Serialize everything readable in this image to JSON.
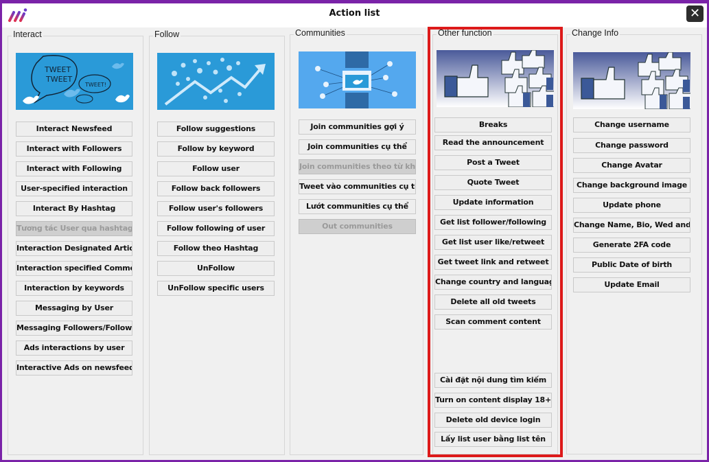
{
  "window": {
    "title": "Action list",
    "logo_icon": "app-logo-icon",
    "close_icon": "close-icon",
    "close_glyph": "✕",
    "accent_color": "#7a23a8",
    "highlight_color": "#dd1a1a"
  },
  "groups": [
    {
      "id": "interact",
      "label": "Interact",
      "banner": "tweet-speech-bubbles-image",
      "buttons": [
        {
          "label": "Interact Newsfeed",
          "enabled": true
        },
        {
          "label": "Interact with Followers",
          "enabled": true
        },
        {
          "label": "Interact with Following",
          "enabled": true
        },
        {
          "label": "User-specified interaction",
          "enabled": true
        },
        {
          "label": "Interact By Hashtag",
          "enabled": true
        },
        {
          "label": "Tương tác User qua hashtag",
          "enabled": false
        },
        {
          "label": "Interaction Designated Articles",
          "enabled": true
        },
        {
          "label": "Interaction specified Comment",
          "enabled": true
        },
        {
          "label": "Interaction by keywords",
          "enabled": true
        },
        {
          "label": "Messaging by User",
          "enabled": true
        },
        {
          "label": "Messaging Followers/Followi...",
          "enabled": true
        },
        {
          "label": "Ads interactions by user",
          "enabled": true
        },
        {
          "label": "Interactive Ads on newsfeed",
          "enabled": true
        }
      ]
    },
    {
      "id": "follow",
      "label": "Follow",
      "banner": "follower-growth-chart-image",
      "buttons": [
        {
          "label": "Follow suggestions",
          "enabled": true
        },
        {
          "label": "Follow by keyword",
          "enabled": true
        },
        {
          "label": "Follow user",
          "enabled": true
        },
        {
          "label": "Follow back followers",
          "enabled": true
        },
        {
          "label": "Follow user's followers",
          "enabled": true
        },
        {
          "label": "Follow following of user",
          "enabled": true
        },
        {
          "label": "Follow theo Hashtag",
          "enabled": true
        },
        {
          "label": "UnFollow",
          "enabled": true
        },
        {
          "label": "UnFollow specific users",
          "enabled": true
        }
      ]
    },
    {
      "id": "communities",
      "label": "Communities",
      "banner": "community-network-image",
      "buttons": [
        {
          "label": "Join communities gợi ý",
          "enabled": true
        },
        {
          "label": "Join communities cụ thể",
          "enabled": true
        },
        {
          "label": "Join communities theo từ khóa",
          "enabled": false
        },
        {
          "label": "Tweet vào communities cụ thể",
          "enabled": true
        },
        {
          "label": "Lướt communities cụ thể",
          "enabled": true
        },
        {
          "label": "Out communities",
          "enabled": false
        }
      ]
    },
    {
      "id": "other",
      "label": "Other function",
      "banner": "thumbs-up-likes-image",
      "buttons": [
        {
          "label": "Breaks",
          "enabled": true
        },
        {
          "label": "Read the announcement",
          "enabled": true
        },
        {
          "label": "Post a Tweet",
          "enabled": true
        },
        {
          "label": "Quote  Tweet",
          "enabled": true
        },
        {
          "label": "Update information",
          "enabled": true
        },
        {
          "label": "Get list follower/following",
          "enabled": true
        },
        {
          "label": "Get list user like/retweet",
          "enabled": true
        },
        {
          "label": "Get tweet link and retweet",
          "enabled": true
        },
        {
          "label": "Change country and language",
          "enabled": true
        },
        {
          "label": "Delete all old tweets",
          "enabled": true
        },
        {
          "label": "Scan comment content",
          "enabled": true
        },
        {
          "label": "Cài đặt nội dung tìm kiếm",
          "enabled": true
        },
        {
          "label": "Turn on content display 18+",
          "enabled": true
        },
        {
          "label": "Delete old device login",
          "enabled": true
        },
        {
          "label": "Lấy list user bằng list tên",
          "enabled": true
        }
      ]
    },
    {
      "id": "change-info",
      "label": "Change Info",
      "banner": "thumbs-up-likes-image",
      "buttons": [
        {
          "label": "Change username",
          "enabled": true
        },
        {
          "label": "Change password",
          "enabled": true
        },
        {
          "label": "Change Avatar",
          "enabled": true
        },
        {
          "label": "Change background image",
          "enabled": true
        },
        {
          "label": "Update phone",
          "enabled": true
        },
        {
          "label": "Change Name, Bio, Wed and ...",
          "enabled": true
        },
        {
          "label": "Generate 2FA code",
          "enabled": true
        },
        {
          "label": "Public Date of birth",
          "enabled": true
        },
        {
          "label": "Update Email",
          "enabled": true
        }
      ]
    }
  ]
}
